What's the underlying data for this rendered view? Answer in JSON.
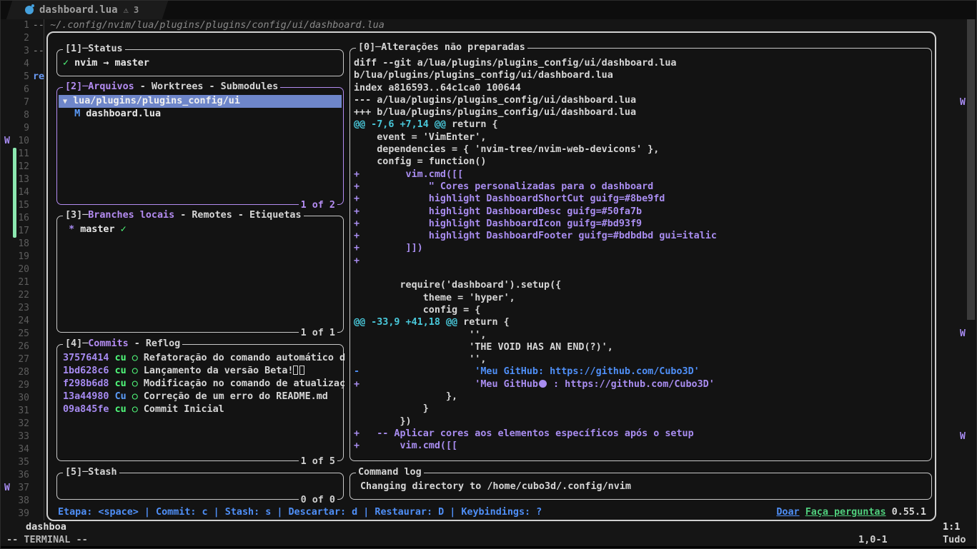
{
  "colors": {
    "accent_purple": "#b48cf2",
    "added_purple": "#a98df0",
    "removed_blue": "#4f8ff7",
    "hunk_cyan": "#49c8da",
    "green": "#50fa7b",
    "selection_blue": "#6e86ca",
    "border_white": "#d0d0d0"
  },
  "tabline": {
    "title": "dashboard.lua",
    "warning_icon": "⚠",
    "warning_count": "3"
  },
  "editor": {
    "line_count": 39,
    "line1_comment": "-- ~/.config/nvim/lua/plugins/plugins/config/ui/dashboard.lua",
    "line3_text": "--",
    "line5_text": "re",
    "sign_marks": [
      {
        "line": 10,
        "label": "W"
      },
      {
        "line": 37,
        "label": "W"
      }
    ],
    "scrollbar_marks": [
      {
        "line": 7,
        "label": "W"
      },
      {
        "line": 25,
        "label": "W"
      },
      {
        "line": 33,
        "label": "W"
      }
    ],
    "added_lines_bar": {
      "from": 11,
      "to": 17
    }
  },
  "lazygit": {
    "status_panel": {
      "number": "[1]",
      "separator": "─",
      "title": "Status",
      "check_icon": "✓",
      "branch_text": "nvim → master"
    },
    "files_panel": {
      "number": "[2]",
      "separator": "─",
      "title": "Arquivos",
      "title_rest": " - Worktrees - Submodules",
      "count": "1 of 2",
      "selected_dir": {
        "arrow_icon": "▼",
        "path": "lua/plugins/plugins_config/ui"
      },
      "file_row": {
        "status": "M",
        "name": "dashboard.lua"
      }
    },
    "branches_panel": {
      "number": "[3]",
      "separator": "─",
      "title": "Branches locais",
      "title_rest": " - Remotes - Etiquetas",
      "count": "1 of 1",
      "row": {
        "star": "*",
        "name": "master",
        "check_icon": "✓"
      }
    },
    "commits_panel": {
      "number": "[4]",
      "separator": "─",
      "title": "Commits",
      "title_rest": " - Reflog",
      "count": "1 of 5",
      "rows": [
        {
          "hash": "37576414",
          "author": "cu",
          "author_color": "green",
          "ring_icon": "○",
          "message": "Refatoração do comando automático d",
          "missing_glyph_boxes": 0
        },
        {
          "hash": "1bd628c6",
          "author": "cu",
          "author_color": "green",
          "ring_icon": "○",
          "message": "Lançamento da versão Beta!",
          "missing_glyph_boxes": 2
        },
        {
          "hash": "f298b6d8",
          "author": "cu",
          "author_color": "green",
          "ring_icon": "○",
          "message": "Modificação no comando de atualizaç",
          "missing_glyph_boxes": 0
        },
        {
          "hash": "13a44980",
          "author": "Cu",
          "author_color": "blue",
          "ring_icon": "○",
          "message": "Correção de um erro do README.md",
          "missing_glyph_boxes": 0
        },
        {
          "hash": "09a845fe",
          "author": "cu",
          "author_color": "green",
          "ring_icon": "○",
          "message": "Commit Inicial",
          "missing_glyph_boxes": 0
        }
      ]
    },
    "stash_panel": {
      "number": "[5]",
      "separator": "─",
      "title": "Stash",
      "count": "0 of 0"
    },
    "diff_panel": {
      "title": "[0]─Alterações não preparadas",
      "lines": [
        {
          "t": "diff --git a/lua/plugins/plugins_config/ui/dashboard.lua",
          "c": "ctx"
        },
        {
          "t": "b/lua/plugins/plugins_config/ui/dashboard.lua",
          "c": "ctx"
        },
        {
          "t": "index a816593..64c1ca0 100644",
          "c": "ctx"
        },
        {
          "t": "--- a/lua/plugins/plugins_config/ui/dashboard.lua",
          "c": "ctx"
        },
        {
          "t": "+++ b/lua/plugins/plugins_config/ui/dashboard.lua",
          "c": "ctx"
        },
        {
          "t": "@@ -7,6 +7,14 @@",
          "c": "hunk",
          "t2": " return {",
          "c2": "ctx"
        },
        {
          "t": "    event = 'VimEnter',",
          "c": "ctx"
        },
        {
          "t": "    dependencies = { 'nvim-tree/nvim-web-devicons' },",
          "c": "ctx"
        },
        {
          "t": "    config = function()",
          "c": "ctx"
        },
        {
          "t": "+        vim.cmd([[",
          "c": "add"
        },
        {
          "t": "+            \" Cores personalizadas para o dashboard",
          "c": "add"
        },
        {
          "t": "+            highlight DashboardShortCut guifg=#8be9fd",
          "c": "add"
        },
        {
          "t": "+            highlight DashboardDesc guifg=#50fa7b",
          "c": "add"
        },
        {
          "t": "+            highlight DashboardIcon guifg=#bd93f9",
          "c": "add"
        },
        {
          "t": "+            highlight DashboardFooter guifg=#bdbdbd gui=italic",
          "c": "add"
        },
        {
          "t": "+        ]])",
          "c": "add"
        },
        {
          "t": "+",
          "c": "add"
        },
        {
          "t": "",
          "c": "ctx"
        },
        {
          "t": "        require('dashboard').setup({",
          "c": "ctx"
        },
        {
          "t": "            theme = 'hyper',",
          "c": "ctx"
        },
        {
          "t": "            config = {",
          "c": "ctx"
        },
        {
          "t": "@@ -33,9 +41,18 @@",
          "c": "hunk",
          "t2": " return {",
          "c2": "ctx"
        },
        {
          "t": "                    '',",
          "c": "ctx"
        },
        {
          "t": "                    'THE VOID HAS AN END(?)',",
          "c": "ctx"
        },
        {
          "t": "                    '',",
          "c": "ctx"
        },
        {
          "t": "-                    'Meu GitHub: https://github.com/Cubo3D'",
          "c": "del"
        },
        {
          "t": "+                    'Meu GitHub",
          "c": "add",
          "icon": "github",
          "t2": " : https://github.com/Cubo3D'",
          "c2": "add"
        },
        {
          "t": "                },",
          "c": "ctx"
        },
        {
          "t": "            }",
          "c": "ctx"
        },
        {
          "t": "        })",
          "c": "ctx"
        },
        {
          "t": "+   -- Aplicar cores aos elementos específicos após o setup",
          "c": "add"
        },
        {
          "t": "+       vim.cmd([[",
          "c": "add"
        }
      ]
    },
    "command_log_panel": {
      "title": "Command log",
      "entry": "Changing directory to /home/cubo3d/.config/nvim"
    },
    "keybindings_bar": {
      "hints": "Etapa: <space> | Commit: c | Stash: s | Descartar: d | Restaurar: D | Keybindings: ?",
      "donate_link": "Doar",
      "ask_link": "Faça perguntas",
      "version": "0.55.1"
    }
  },
  "statusline": {
    "buffer_name": "dashboa",
    "cursor_short": "1:1"
  },
  "cmdline": {
    "mode_indicator": "-- TERMINAL --",
    "ruler": "1,0-1",
    "scroll_position": "Tudo"
  }
}
